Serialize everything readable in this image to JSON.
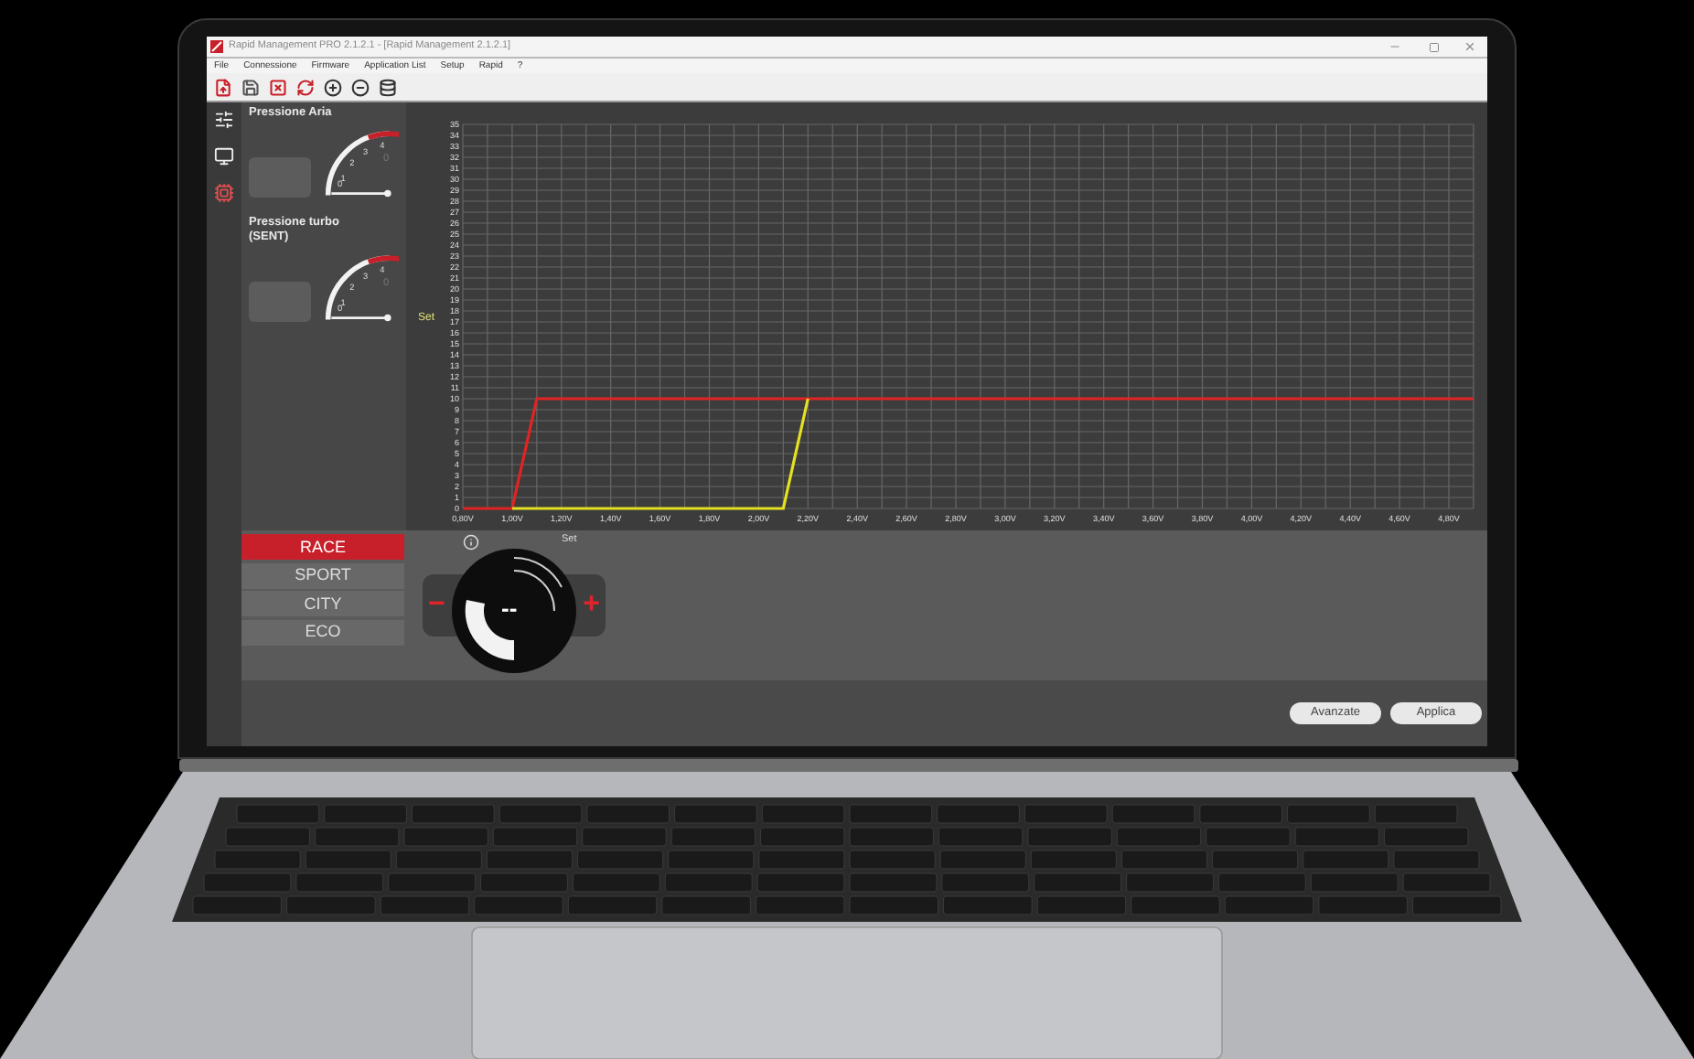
{
  "window": {
    "title": "Rapid Management PRO 2.1.2.1 - [Rapid Management  2.1.2.1]"
  },
  "menu": [
    "File",
    "Connessione",
    "Firmware",
    "Application List",
    "Setup",
    "Rapid",
    "?"
  ],
  "gauges": [
    {
      "title": "Pressione Aria",
      "scale": [
        "0",
        "1",
        "2",
        "3",
        "4"
      ],
      "reading": "0"
    },
    {
      "title": "Pressione turbo (SENT)",
      "scale": [
        "0",
        "1",
        "2",
        "3",
        "4"
      ],
      "reading": "0"
    }
  ],
  "chart": {
    "chart_data": {
      "type": "line",
      "ylabel": "Set",
      "x": [
        0.8,
        1.0,
        1.1,
        2.1,
        2.2,
        4.9
      ],
      "series": [
        {
          "color": "#e02424",
          "values": [
            0,
            0,
            10,
            10,
            10,
            10
          ]
        },
        {
          "color": "#e4e022",
          "values": [
            null,
            0,
            0,
            0,
            10,
            null
          ]
        }
      ],
      "grid": true,
      "xlim": [
        0.8,
        4.9
      ],
      "ylim": [
        0,
        35
      ],
      "xticks": [
        {
          "value": 0.8,
          "label": "0,80V"
        },
        {
          "value": 1.0,
          "label": "1,00V"
        },
        {
          "value": 1.2,
          "label": "1,20V"
        },
        {
          "value": 1.4,
          "label": "1,40V"
        },
        {
          "value": 1.6,
          "label": "1,60V"
        },
        {
          "value": 1.8,
          "label": "1,80V"
        },
        {
          "value": 2.0,
          "label": "2,00V"
        },
        {
          "value": 2.2,
          "label": "2,20V"
        },
        {
          "value": 2.4,
          "label": "2,40V"
        },
        {
          "value": 2.6,
          "label": "2,60V"
        },
        {
          "value": 2.8,
          "label": "2,80V"
        },
        {
          "value": 3.0,
          "label": "3,00V"
        },
        {
          "value": 3.2,
          "label": "3,20V"
        },
        {
          "value": 3.4,
          "label": "3,40V"
        },
        {
          "value": 3.6,
          "label": "3,60V"
        },
        {
          "value": 3.8,
          "label": "3,80V"
        },
        {
          "value": 4.0,
          "label": "4,00V"
        },
        {
          "value": 4.2,
          "label": "4,20V"
        },
        {
          "value": 4.4,
          "label": "4,40V"
        },
        {
          "value": 4.6,
          "label": "4,60V"
        },
        {
          "value": 4.8,
          "label": "4,80V"
        }
      ],
      "yticks": [
        0,
        1,
        2,
        3,
        4,
        5,
        6,
        7,
        8,
        9,
        10,
        11,
        12,
        13,
        14,
        15,
        16,
        17,
        18,
        19,
        20,
        21,
        22,
        23,
        24,
        25,
        26,
        27,
        28,
        29,
        30,
        31,
        32,
        33,
        34,
        35
      ]
    }
  },
  "modes": [
    {
      "label": "RACE",
      "selected": true
    },
    {
      "label": "SPORT",
      "selected": false
    },
    {
      "label": "CITY",
      "selected": false
    },
    {
      "label": "ECO",
      "selected": false
    }
  ],
  "dial": {
    "label": "Set",
    "value": "--",
    "minus": "−",
    "plus": "+"
  },
  "buttons": [
    "Avanzate",
    "Applica"
  ]
}
